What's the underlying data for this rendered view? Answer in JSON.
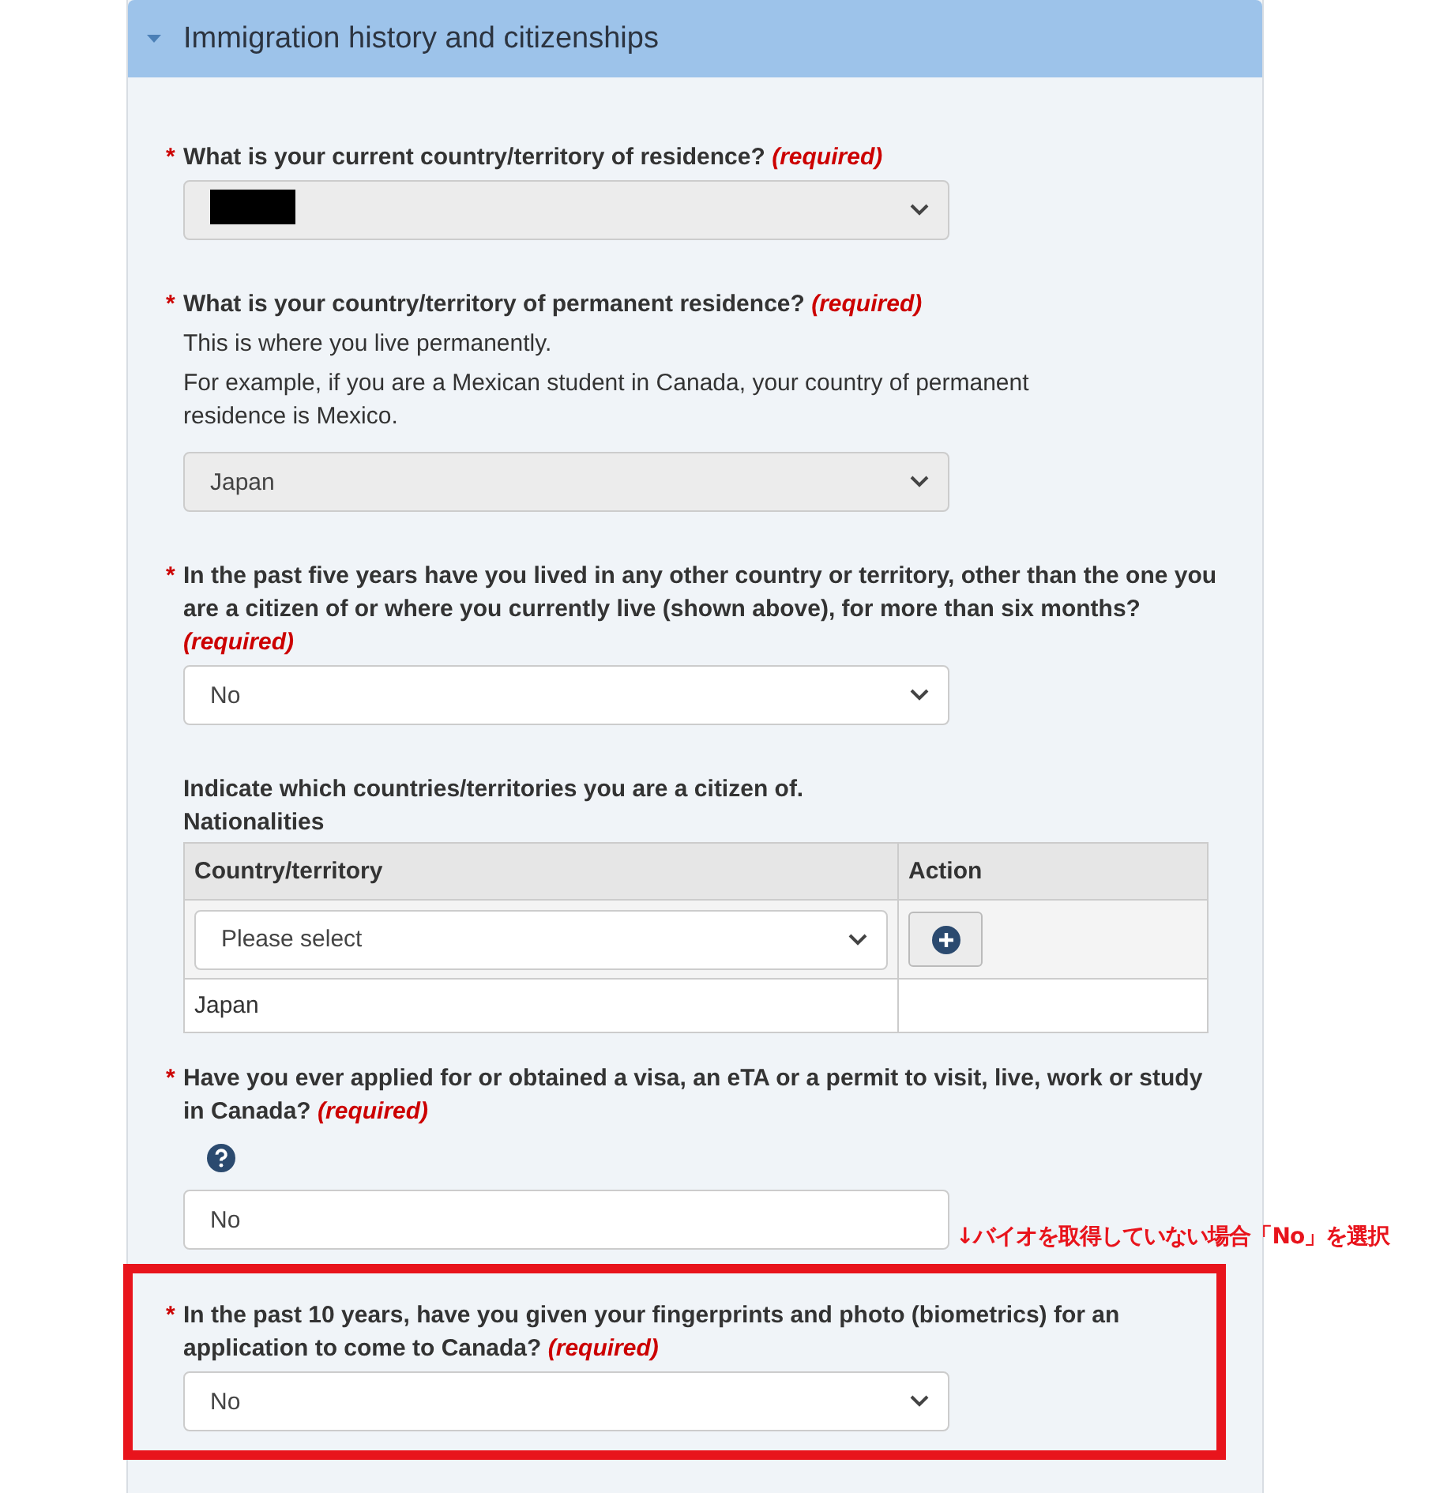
{
  "section": {
    "title": "Immigration history and citizenships",
    "expanded": true
  },
  "questions": [
    {
      "kind": "select",
      "required": true,
      "required_marker": "*",
      "label": "What is your current country/territory of residence?",
      "required_note": "(required)",
      "redacted": true,
      "disabled": true
    },
    {
      "kind": "select",
      "required": true,
      "required_marker": "*",
      "label": "What is your country/territory of permanent residence?",
      "required_note": "(required)",
      "help": [
        "This is where you live permanently.",
        "For example, if you are a Mexican student in Canada, your country of permanent residence is Mexico."
      ],
      "value": "Japan",
      "disabled": true
    },
    {
      "kind": "select",
      "required": true,
      "required_marker": "*",
      "label": "In the past five years have you lived in any other country or territory, other than the one you are a citizen of or where you currently live (shown above), for more than six months?",
      "required_note": "(required)",
      "value": "No",
      "disabled": false
    },
    {
      "kind": "table",
      "label": "Indicate which countries/territories you are a citizen of.",
      "caption": "Nationalities",
      "columns": [
        "Country/territory",
        "Action"
      ],
      "placeholder": "Please select",
      "rows": [
        {
          "country": "Japan"
        }
      ]
    },
    {
      "kind": "select",
      "required": true,
      "required_marker": "*",
      "label": "Have you ever applied for or obtained a visa, an eTA or a permit to visit, live, work or study in Canada?",
      "required_note": "(required)",
      "help_icon": true,
      "value": "No",
      "disabled": false,
      "chevron": false
    },
    {
      "kind": "select",
      "required": true,
      "required_marker": "*",
      "label": "In the past 10 years, have you given your fingerprints and photo (biometrics) for an application to come to Canada?",
      "required_note": "(required)",
      "value": "No",
      "disabled": false,
      "highlighted": true,
      "annotation": "↓バイオを取得していない場合「No」を選択"
    }
  ]
}
